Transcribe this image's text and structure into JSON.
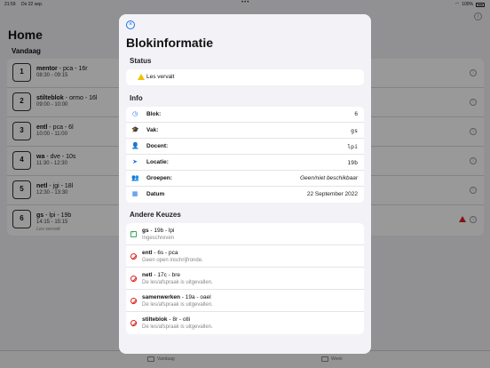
{
  "status_bar": {
    "time": "21:59",
    "date": "Do 22 sep.",
    "wifi": "wifi-icon",
    "battery": "100%"
  },
  "home": {
    "title": "Home",
    "section": "Vandaag",
    "rows": [
      {
        "num": "1",
        "subject": "mentor",
        "detail": " - pca - 16r",
        "time": "08:30 - 09:15",
        "note": ""
      },
      {
        "num": "2",
        "subject": "stilteblok",
        "detail": " - ormo - 16l",
        "time": "09:00 - 10:00",
        "note": ""
      },
      {
        "num": "3",
        "subject": "entl",
        "detail": " - pca - 6l",
        "time": "10:00 - 11:00",
        "note": ""
      },
      {
        "num": "4",
        "subject": "wa",
        "detail": " - dve - 10s",
        "time": "11:30 - 12:30",
        "note": ""
      },
      {
        "num": "5",
        "subject": "netl",
        "detail": " - jgi - 18l",
        "time": "12:30 - 13:30",
        "note": ""
      },
      {
        "num": "6",
        "subject": "gs",
        "detail": " - lpi - 19b",
        "time": "14:15 - 15:15",
        "note": "Les vervalt"
      }
    ]
  },
  "tabbar": {
    "tab1": "Vandaag",
    "tab2": "Week"
  },
  "modal": {
    "title": "Blokinformatie",
    "status_heading": "Status",
    "status_text": "Les vervalt",
    "info_heading": "Info",
    "info": [
      {
        "icon": "clock-icon",
        "glyph": "◷",
        "label": "Blok:",
        "value": "6"
      },
      {
        "icon": "graduation-cap-icon",
        "glyph": "🎓",
        "label": "Vak:",
        "value": "gs"
      },
      {
        "icon": "person-icon",
        "glyph": "👤",
        "label": "Docent:",
        "value": "lpi"
      },
      {
        "icon": "location-arrow-icon",
        "glyph": "➤",
        "label": "Locatie:",
        "value": "19b"
      },
      {
        "icon": "group-icon",
        "glyph": "👥",
        "label": "Groepen:",
        "value": "Geen/niet beschikbaar"
      },
      {
        "icon": "calendar-icon",
        "glyph": "▦",
        "label": "Datum",
        "value": "22 September 2022"
      }
    ],
    "choices_heading": "Andere Keuzes",
    "choices": [
      {
        "subject": "gs",
        "detail": " - 19b - lpi",
        "sub": "Ingeschreven",
        "state": "enrolled"
      },
      {
        "subject": "entl",
        "detail": " - 6s - pca",
        "sub": "Geen open inschrijfronde.",
        "state": "unavailable"
      },
      {
        "subject": "netl",
        "detail": " - 17c - bre",
        "sub": "De les/afspraak is uitgevallen.",
        "state": "unavailable"
      },
      {
        "subject": "samenwerken",
        "detail": " - 19a - oael",
        "sub": "De les/afspraak is uitgevallen.",
        "state": "unavailable"
      },
      {
        "subject": "stilteblok",
        "detail": " - 8r - otli",
        "sub": "De les/afspraak is uitgevallen.",
        "state": "unavailable"
      }
    ]
  }
}
